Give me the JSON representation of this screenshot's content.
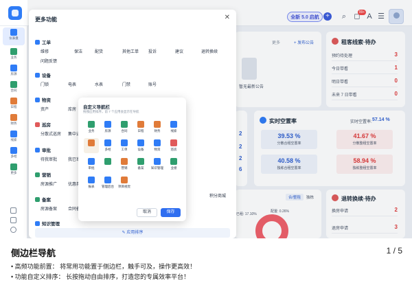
{
  "topbar": {
    "version_label": "全新 5.0 启航",
    "plus": "+",
    "notification_count": "99+"
  },
  "rail": {
    "items": [
      {
        "label": "仪表盘",
        "icon": "dashboard-icon",
        "color": "#2f7cf6"
      },
      {
        "label": "业务",
        "icon": "business-icon",
        "color": "#2f9e6e"
      },
      {
        "label": "房源",
        "icon": "house-icon",
        "color": "#2f7cf6"
      },
      {
        "label": "合同",
        "icon": "contract-icon",
        "color": "#2f9e6e"
      },
      {
        "label": "日程",
        "icon": "calendar-icon",
        "color": "#e07b39"
      },
      {
        "label": "财务",
        "icon": "finance-icon",
        "color": "#e07b39"
      },
      {
        "label": "线索",
        "icon": "leads-icon",
        "color": "#2f7cf6"
      },
      {
        "label": "多经",
        "icon": "multi-icon",
        "color": "#2f7cf6"
      },
      {
        "label": "更多",
        "icon": "more-icon",
        "color": "#2f9e6e"
      }
    ]
  },
  "modal": {
    "title": "更多功能",
    "close": "✕",
    "sections": [
      {
        "title": "工单",
        "icon_color": "#2f7cf6",
        "items": [
          "维修",
          "保洁",
          "配货",
          "其他工单",
          "投诉",
          "建议",
          "退转换续",
          "问题反馈"
        ]
      },
      {
        "title": "设备",
        "icon_color": "#2f7cf6",
        "items": [
          "门锁",
          "电表",
          "水表",
          "门禁",
          "账号"
        ]
      },
      {
        "title": "物资",
        "icon_color": "#2f7cf6",
        "items": [
          "资产",
          "库房"
        ]
      },
      {
        "title": "巡房",
        "icon_color": "#e05a5a",
        "items": [
          "分散式巡房",
          "集中式"
        ]
      },
      {
        "title": "审批",
        "icon_color": "#2f7cf6",
        "items": [
          "待我审批",
          "我已审"
        ]
      },
      {
        "title": "营销",
        "icon_color": "#2f9e6e",
        "items": [
          "房源推广",
          "优惠券"
        ]
      },
      {
        "title": "备案",
        "icon_color": "#2f9e6e",
        "items": [
          "房源备案",
          "合同备"
        ]
      },
      {
        "title": "知识管理",
        "icon_color": "#2f7cf6",
        "items": []
      }
    ],
    "extra_items": [
      "积分商城"
    ],
    "apply_label": "应用排序"
  },
  "popover": {
    "title": "自定义导航栏",
    "subtitle": "拖拽应用排序，前 7 个应用会显示在导航",
    "items": [
      {
        "label": "业务",
        "color": "#2f9e6e"
      },
      {
        "label": "房源",
        "color": "#2f7cf6"
      },
      {
        "label": "合同",
        "color": "#2f9e6e"
      },
      {
        "label": "日程",
        "color": "#e07b39"
      },
      {
        "label": "财务",
        "color": "#e07b39"
      },
      {
        "label": "线索",
        "color": "#2f7cf6"
      },
      {
        "label": "",
        "color": "#e07b39"
      },
      {
        "label": "多经",
        "color": "#2f7cf6"
      },
      {
        "label": "工单",
        "color": "#2f7cf6"
      },
      {
        "label": "设备",
        "color": "#2f7cf6"
      },
      {
        "label": "物资",
        "color": "#2f7cf6"
      },
      {
        "label": "巡房",
        "color": "#e05a5a"
      },
      {
        "label": "审批",
        "color": "#2f7cf6"
      },
      {
        "label": "",
        "color": "#2f9e6e"
      },
      {
        "label": "营销",
        "color": "#e07b39"
      },
      {
        "label": "备案",
        "color": "#2f9e6e"
      },
      {
        "label": "知识管理",
        "color": "#2f7cf6"
      },
      {
        "label": "业绩",
        "color": "#2f9e6e"
      },
      {
        "label": "报表",
        "color": "#2f7cf6"
      },
      {
        "label": "管理后台",
        "color": "#2f7cf6"
      },
      {
        "label": "项目视觉",
        "color": "#e07b39"
      }
    ],
    "cancel_label": "取消",
    "save_label": "保存"
  },
  "dashboard": {
    "announce": {
      "more": "更多",
      "add": "+ 发布公告",
      "empty": "暂无最新公告"
    },
    "tenant_todo": {
      "title": "租客线索·待办",
      "rows": [
        {
          "label": "预约待处理",
          "value": "3"
        },
        {
          "label": "今日带看",
          "value": "1"
        },
        {
          "label": "明日带看",
          "value": "0"
        },
        {
          "label": "未来 7 日带看",
          "value": "0"
        }
      ]
    },
    "vacancy": {
      "title": "实时空置率",
      "realtime_label": "实时空置率:",
      "realtime_value": "57.14 %",
      "boxes": [
        {
          "value": "39.53 %",
          "label": "分散合租空置率",
          "color": "#2f5fd0",
          "bg": "#eef3fb"
        },
        {
          "value": "41.67 %",
          "label": "分散整租空置率",
          "color": "#e03a3a",
          "bg": "#fdeeee"
        },
        {
          "value": "40.58 %",
          "label": "独栋合租空置率",
          "color": "#2f5fd0",
          "bg": "#eef3fb"
        },
        {
          "value": "58.94 %",
          "label": "独栋整租空置率",
          "color": "#e03a3a",
          "bg": "#fdeeee"
        }
      ]
    },
    "left_numbers": [
      "2",
      "2",
      "2",
      "6"
    ],
    "pie": {
      "tab_active": "合/整租",
      "tab_other": "独栋",
      "label_a": "已租: 17.10%",
      "label_b": "配置: 0.26%"
    },
    "renew": {
      "title": "退转换续·待办",
      "rows": [
        {
          "label": "换房申请",
          "value": "2"
        },
        {
          "label": "退房申请",
          "value": "3"
        }
      ]
    }
  },
  "caption": {
    "title": "侧边栏导航",
    "page": "1 / 5",
    "lines": [
      "• 高频功能前置： 将常用功能置于侧边栏，触手可及，操作更高效！",
      "• 功能自定义排序： 长按拖动自由排序，打造您的专属效率平台！"
    ]
  }
}
